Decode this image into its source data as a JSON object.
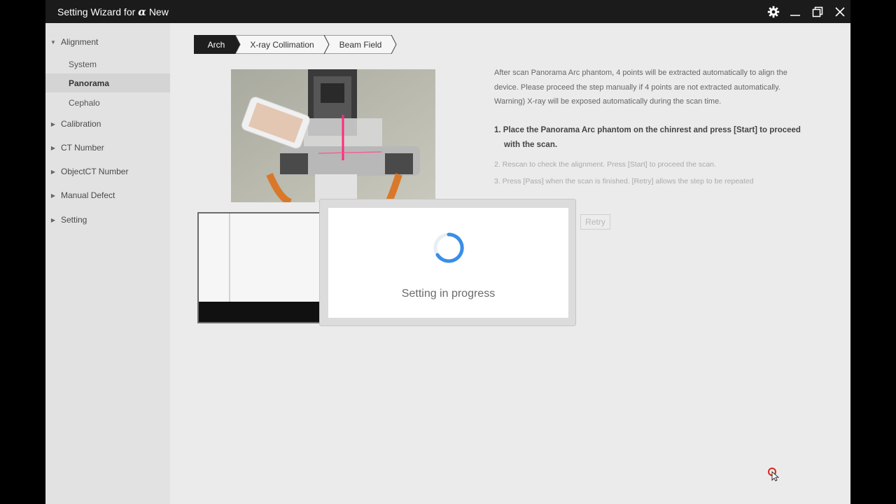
{
  "window": {
    "title_prefix": "Setting Wizard for",
    "title_brand": "α",
    "title_suffix": "New"
  },
  "titlebar_icons": [
    "gear-icon",
    "minimize-icon",
    "restore-icon",
    "close-icon"
  ],
  "sidebar": {
    "groups": [
      {
        "label": "Alignment",
        "expanded": true,
        "items": [
          {
            "label": "System",
            "active": false
          },
          {
            "label": "Panorama",
            "active": true
          },
          {
            "label": "Cephalo",
            "active": false
          }
        ]
      },
      {
        "label": "Calibration",
        "expanded": false
      },
      {
        "label": "CT Number",
        "expanded": false
      },
      {
        "label": "ObjectCT Number",
        "expanded": false
      },
      {
        "label": "Manual Defect",
        "expanded": false
      },
      {
        "label": "Setting",
        "expanded": false
      }
    ]
  },
  "tabs": [
    {
      "label": "Arch",
      "active": true
    },
    {
      "label": "X-ray Collimation",
      "active": false
    },
    {
      "label": "Beam Field",
      "active": false
    }
  ],
  "instructions": {
    "intro": "After scan Panorama Arc phantom, 4 points will be extracted automatically to align the device. Please proceed the step manually if 4 points are not extracted automatically.",
    "warning": "Warning) X-ray will be exposed automatically during the scan time.",
    "step1": "1. Place the Panorama Arc phantom on the chinrest and press [Start] to proceed with the scan.",
    "step2": "2. Rescan to check the alignment. Press [Start] to proceed the scan.",
    "step3": "3. Press [Pass] when the scan is finished. [Retry] allows the step to be repeated"
  },
  "buttons": {
    "retry": "Retry"
  },
  "modal": {
    "message": "Setting in progress"
  },
  "colors": {
    "active_tab": "#1e1e1e",
    "titlebar": "#1b1b1b",
    "spinner": "#3a8ee6",
    "cursor_ring": "#d9261c"
  }
}
